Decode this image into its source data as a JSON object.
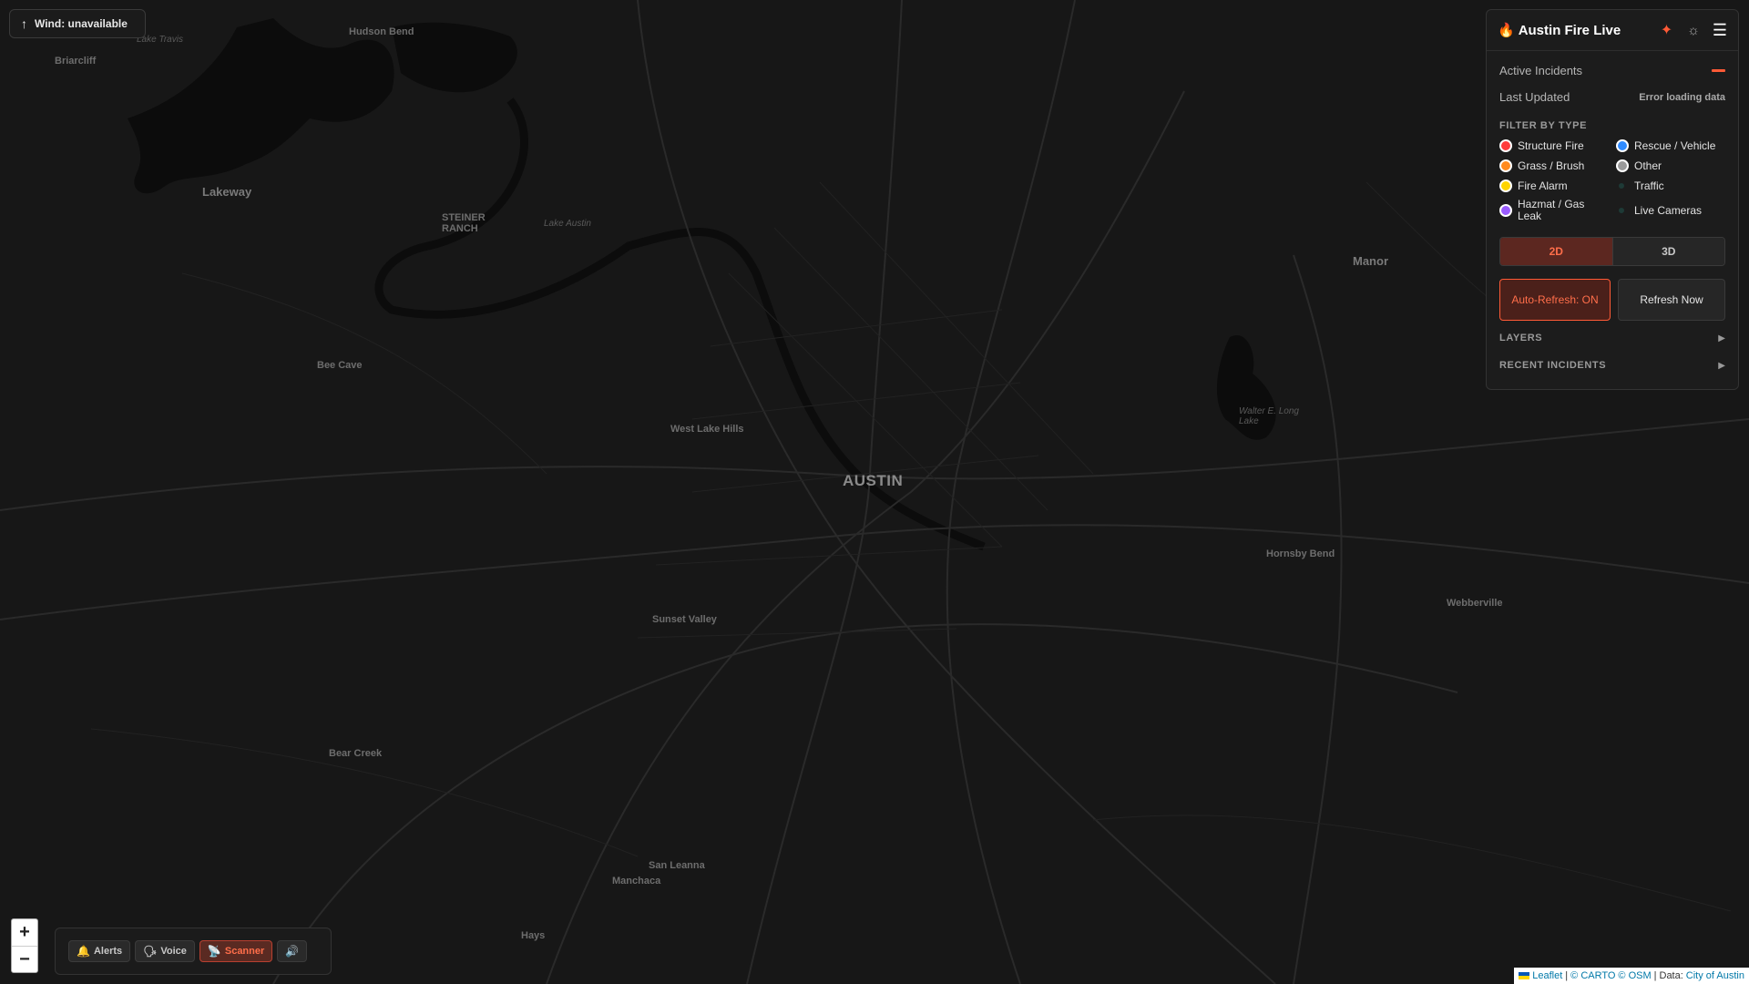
{
  "map": {
    "labels": {
      "austin": "AUSTIN",
      "lakeway": "Lakeway",
      "hudson_bend": "Hudson Bend",
      "briarcliff": "Briarcliff",
      "steiner_ranch": "STEINER\nRANCH",
      "lake_austin": "Lake Austin",
      "bee_cave": "Bee Cave",
      "west_lake_hills": "West Lake Hills",
      "sunset_valley": "Sunset Valley",
      "bear_creek": "Bear Creek",
      "manchaca": "Manchaca",
      "san_leanna": "San Leanna",
      "hays": "Hays",
      "manor": "Manor",
      "hornsby_bend": "Hornsby Bend",
      "webberville": "Webberville",
      "walter_e_long": "Walter E. Long\nLake",
      "lake_travis": "Lake Travis"
    }
  },
  "wind": {
    "text": "Wind: unavailable",
    "arrow": "↑"
  },
  "panel": {
    "title": "Austin Fire Live",
    "icons": {
      "logo": "flame-icon",
      "pin": "pin-icon",
      "theme": "sun-icon",
      "menu": "hamburger-icon"
    },
    "active_incidents_label": "Active Incidents",
    "active_incidents_value": "—",
    "last_updated_label": "Last Updated",
    "last_updated_value": "Error loading data",
    "filter_title": "FILTER BY TYPE",
    "filters": [
      {
        "label": "Structure Fire",
        "color": "#ff3b3b"
      },
      {
        "label": "Rescue / Vehicle",
        "color": "#2f8bff"
      },
      {
        "label": "Grass / Brush",
        "color": "#ff8a1f"
      },
      {
        "label": "Other",
        "color": "#9a9a9a"
      },
      {
        "label": "Fire Alarm",
        "color": "#ffd400"
      },
      {
        "label": "Traffic",
        "color": "#1e3a36"
      },
      {
        "label": "Hazmat / Gas Leak",
        "color": "#9b5cff"
      },
      {
        "label": "Live Cameras",
        "color": "#1e3a36"
      }
    ],
    "view_2d": "2D",
    "view_3d": "3D",
    "auto_refresh": "Auto-Refresh: ON",
    "refresh_now": "Refresh Now",
    "layers": "LAYERS",
    "recent_incidents": "RECENT INCIDENTS",
    "chevron": "▶"
  },
  "zoom": {
    "in": "+",
    "out": "−"
  },
  "toolbar": {
    "alerts": "Alerts",
    "voice": "Voice",
    "scanner": "Scanner",
    "icons": {
      "alerts": "bell-icon",
      "voice": "speaking-head-icon",
      "scanner": "satellite-dish-icon",
      "sound": "speaker-icon"
    }
  },
  "attribution": {
    "leaflet": "Leaflet",
    "sep1": "|",
    "carto": "© CARTO",
    "osm": "© OSM",
    "sep2": "|",
    "data": "Data:",
    "city": "City of Austin"
  }
}
